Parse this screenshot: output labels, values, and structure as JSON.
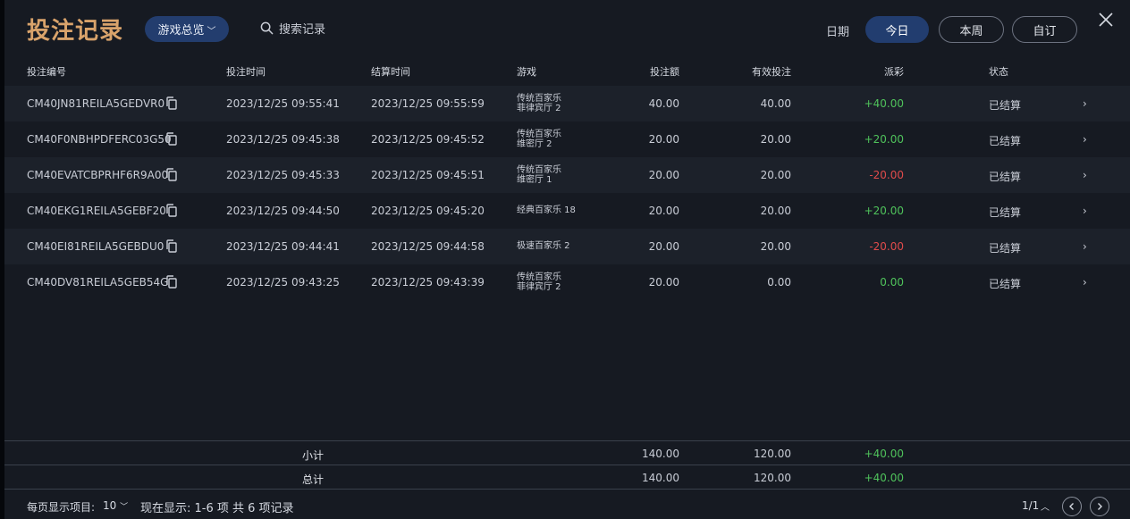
{
  "header": {
    "title": "投注记录",
    "game_filter": "游戏总览",
    "search_placeholder": "搜索记录",
    "date_label": "日期",
    "date_buttons": [
      "今日",
      "本周",
      "自订"
    ],
    "active_date": "今日"
  },
  "table": {
    "columns": [
      "投注编号",
      "投注时间",
      "结算时间",
      "游戏",
      "投注额",
      "有效投注",
      "派彩",
      "状态"
    ],
    "rows": [
      {
        "id": "CM40JN81REILA5GEDVR0",
        "bet_time": "2023/12/25 09:55:41",
        "settle_time": "2023/12/25 09:55:59",
        "game1": "传统百家乐",
        "game2": "菲律宾厅 2",
        "amount": "40.00",
        "valid": "40.00",
        "payout": "+40.00",
        "status": "已结算"
      },
      {
        "id": "CM40F0NBHPDFERC03G50",
        "bet_time": "2023/12/25 09:45:38",
        "settle_time": "2023/12/25 09:45:52",
        "game1": "传统百家乐",
        "game2": "维密厅 2",
        "amount": "20.00",
        "valid": "20.00",
        "payout": "+20.00",
        "status": "已结算"
      },
      {
        "id": "CM40EVATCBPRHF6R9A00",
        "bet_time": "2023/12/25 09:45:33",
        "settle_time": "2023/12/25 09:45:51",
        "game1": "传统百家乐",
        "game2": "维密厅 1",
        "amount": "20.00",
        "valid": "20.00",
        "payout": "-20.00",
        "status": "已结算"
      },
      {
        "id": "CM40EKG1REILA5GEBF20",
        "bet_time": "2023/12/25 09:44:50",
        "settle_time": "2023/12/25 09:45:20",
        "game1": "经典百家乐 18",
        "game2": "",
        "amount": "20.00",
        "valid": "20.00",
        "payout": "+20.00",
        "status": "已结算"
      },
      {
        "id": "CM40EI81REILA5GEBDU0",
        "bet_time": "2023/12/25 09:44:41",
        "settle_time": "2023/12/25 09:44:58",
        "game1": "极速百家乐 2",
        "game2": "",
        "amount": "20.00",
        "valid": "20.00",
        "payout": "-20.00",
        "status": "已结算"
      },
      {
        "id": "CM40DV81REILA5GEB54G",
        "bet_time": "2023/12/25 09:43:25",
        "settle_time": "2023/12/25 09:43:39",
        "game1": "传统百家乐",
        "game2": "菲律宾厅 2",
        "amount": "20.00",
        "valid": "0.00",
        "payout": "0.00",
        "status": "已结算"
      }
    ]
  },
  "totals": {
    "subtotal": {
      "label": "小计",
      "amount": "140.00",
      "valid": "120.00",
      "payout": "+40.00"
    },
    "total": {
      "label": "总计",
      "amount": "140.00",
      "valid": "120.00",
      "payout": "+40.00"
    }
  },
  "footer": {
    "per_page_label": "每页显示项目:",
    "per_page_value": "10",
    "showing": "现在显示:  1-6 项 共 6 项记录",
    "page": "1/1"
  },
  "colors": {
    "accent": "#223d6f",
    "title": "#d9a36b",
    "positive": "#4fc25b",
    "negative": "#e04b4b"
  }
}
